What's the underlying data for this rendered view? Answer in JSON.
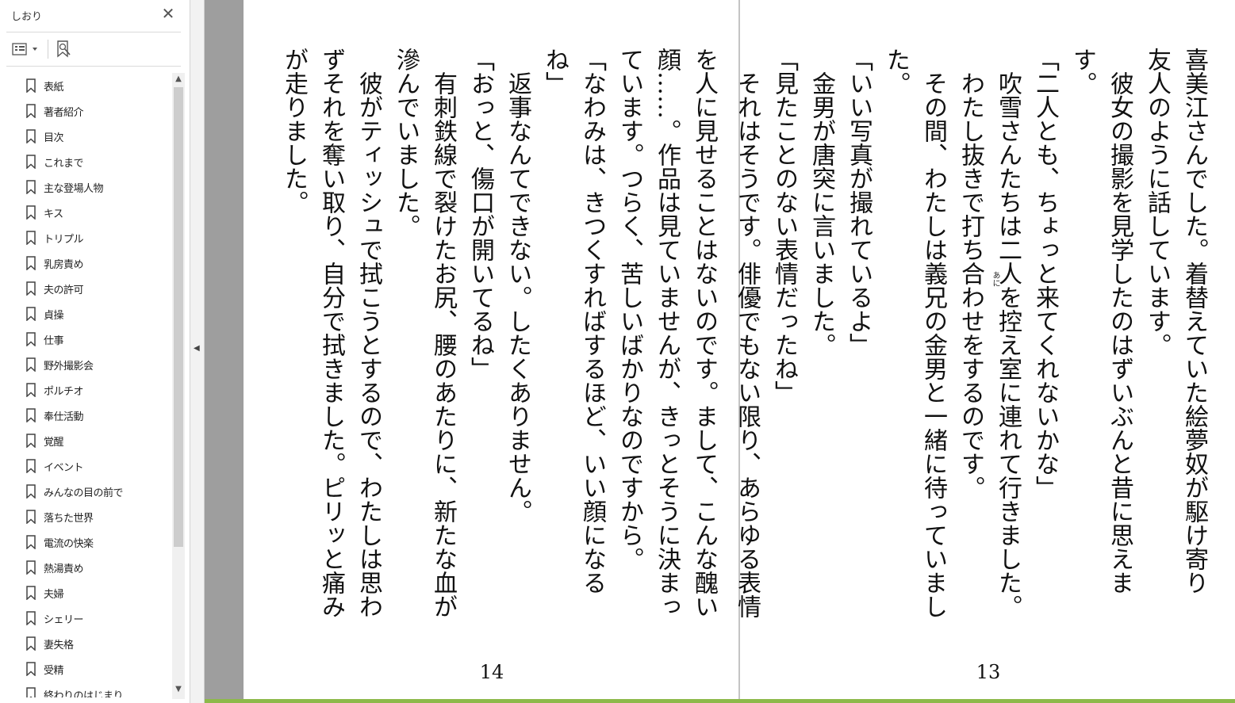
{
  "panel": {
    "title": "しおり",
    "bookmarks": [
      "表紙",
      "著者紹介",
      "目次",
      "これまで",
      "主な登場人物",
      "キス",
      "トリプル",
      "乳房責め",
      "夫の許可",
      "貞操",
      "仕事",
      "野外撮影会",
      "ポルチオ",
      "奉仕活動",
      "覚醒",
      "イベント",
      "みんなの目の前で",
      "落ちた世界",
      "電流の快楽",
      "熱湯責め",
      "夫婦",
      "シェリー",
      "妻失格",
      "受精",
      "終わりのはじまり"
    ]
  },
  "colors": {
    "viewer_background": "#9e9e9e",
    "accent_bar": "#8db94a"
  },
  "pages": {
    "right": {
      "number": "13",
      "text": "喜美江さんでした。着替えていた絵夢奴が駆け寄り\n友人のように話しています。\n　彼女の撮影を見学したのはずいぶんと昔に思えます。\n「二人とも、ちょっと来てくれないかな」\n　吹雪さんたちは二人を控え室に連れて行きました。\n　わたし抜きで打ち合わせをするのです。\n　その間、わたしは義兄の金男と一緒に待っていまし\nた。\n「いい写真が撮れているよ」\n　金男が唐突に言いました。\n「見たことのない表情だったね」\n　それはそうです。俳優でもない限り、あらゆる表情",
      "ruby": "あに"
    },
    "left": {
      "number": "14",
      "text": "を人に見せることはないのです。まして、こんな醜い\n顔……。作品は見ていませんが、きっとそうに決まっ\nています。つらく、苦しいばかりなのですから。\n「なわみは、きつくすればするほど、いい顔になる\nね」\n　返事なんてできない。したくありません。\n「おっと、傷口が開いてるね」\n　有刺鉄線で裂けたお尻、腰のあたりに、新たな血が\n滲んでいました。\n　彼がティッシュで拭こうとするので、わたしは思わ\nずそれを奪い取り、自分で拭きました。ピリッと痛み\nが走りました。"
    }
  }
}
